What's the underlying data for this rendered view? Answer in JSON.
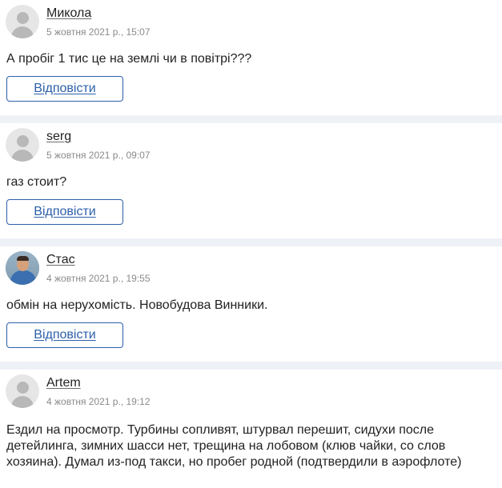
{
  "comments": [
    {
      "author": "Микола",
      "date": "5 жовтня 2021 р., 15:07",
      "text": "А пробіг 1 тис це на землі чи в повітрі???",
      "reply_label": "Відповісти",
      "avatar": "default-user-icon"
    },
    {
      "author": "serg",
      "date": "5 жовтня 2021 р., 09:07",
      "text": "газ стоит?",
      "reply_label": "Відповісти",
      "avatar": "default-user-icon"
    },
    {
      "author": "Стас",
      "date": "4 жовтня 2021 р., 19:55",
      "text": "обмін на нерухомість. Новобудова Винники.",
      "reply_label": "Відповісти",
      "avatar": "user-photo"
    },
    {
      "author": "Artem",
      "date": "4 жовтня 2021 р., 19:12",
      "text": "Ездил на просмотр. Турбины сопливят, штурвал перешит, сидухи после детейлинга, зимних шасси нет, трещина на лобовом (клюв чайки, со слов хозяина). Думал из-под такси, но пробег родной (подтвердили в аэрофлоте)",
      "avatar": "default-user-icon"
    }
  ]
}
